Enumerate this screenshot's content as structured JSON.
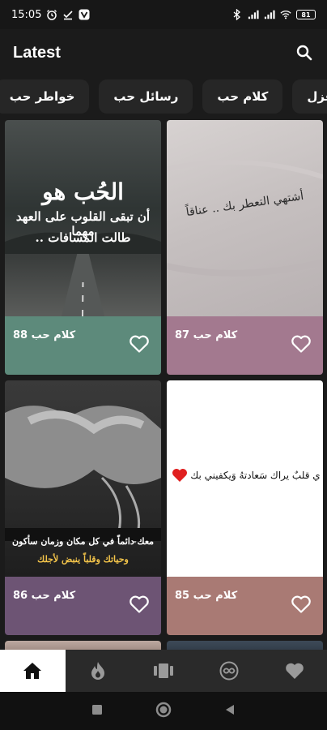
{
  "status_bar": {
    "time": "15:05",
    "battery": "81"
  },
  "app_bar": {
    "title": "Latest"
  },
  "chips": [
    {
      "label": "غزل"
    },
    {
      "label": "كلام حب"
    },
    {
      "label": "رسائل حب"
    },
    {
      "label": "خواطر حب"
    }
  ],
  "cards": [
    {
      "label": "كلام حب 88",
      "image_text": [
        "الحُب هو",
        "أن تبقى القلوب على العهد مهما",
        "طالت المسافات .."
      ],
      "footer_color": "#5d8a7b"
    },
    {
      "label": "كلام حب 87",
      "image_text": [
        "أشتهي التعطر بك .. عناقاً"
      ],
      "footer_color": "#a3798f"
    },
    {
      "label": "كلام حب 86",
      "image_text": [
        "معك دائماً في كل مكان وزمان سأكون",
        "وحياتك وقلباً ينبض لأجلك"
      ],
      "footer_color": "#6d5474"
    },
    {
      "label": "كلام حب 85",
      "image_text": [
        "ي قلبٌ يراك سَعادتهُ وَيكفيني بك"
      ],
      "footer_color": "#a97a74"
    }
  ],
  "colors": {
    "background": "#1b1b1b",
    "chip_bg": "#262626",
    "nav_bg": "#2a2a2a",
    "nav_active": "#ffffff"
  },
  "bottom_nav": [
    {
      "icon": "home-icon",
      "active": true
    },
    {
      "icon": "flame-icon",
      "active": false
    },
    {
      "icon": "carousel-icon",
      "active": false
    },
    {
      "icon": "infinity-icon",
      "active": false
    },
    {
      "icon": "heart-icon",
      "active": false
    }
  ]
}
